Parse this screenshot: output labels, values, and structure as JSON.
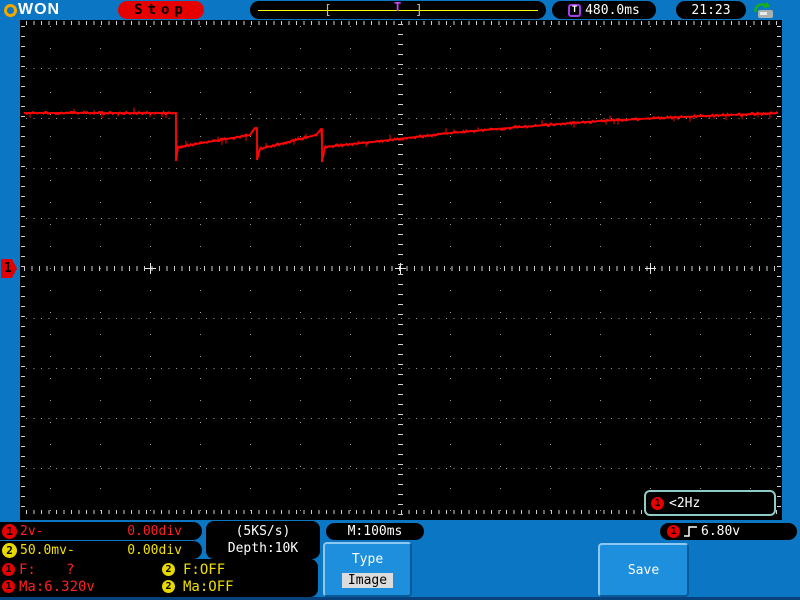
{
  "header": {
    "brand_suffix": "WON",
    "run_status": "Stop",
    "memory_bar": {
      "left_bracket": "[",
      "right_bracket": "]",
      "trigger_marker": "T"
    },
    "trigger_icon_letter": "T",
    "trigger_time": "480.0ms",
    "clock": "21:23",
    "usb_icon": "usb-save-icon"
  },
  "scope": {
    "channel_marker": "1",
    "freq_counter": {
      "channel_badge": "1",
      "value": "<2Hz"
    }
  },
  "footer": {
    "ch1": {
      "badge": "1",
      "scale": "2v-",
      "position": "0.00div"
    },
    "ch2": {
      "badge": "2",
      "scale": "50.0mv-",
      "position": "0.00div"
    },
    "sample_rate": "(5KS/s)",
    "depth": "Depth:10K",
    "timebase": "M:100ms",
    "trigger": {
      "badge": "1",
      "level": "6.80v"
    },
    "measurements": {
      "ch1_badge": "1",
      "ch2_badge": "2",
      "ch1_freq_label": "F:",
      "ch1_freq_value": "?",
      "ch1_max": "Ma:6.320v",
      "ch2_freq": "F:OFF",
      "ch2_max": "Ma:OFF"
    },
    "type_button": {
      "label": "Type",
      "value": "Image"
    },
    "save_button_label": "Save"
  },
  "colors": {
    "bezel_blue": "#0b76c4",
    "trace_red": "#ff0505",
    "ch1_red": "#ff2020",
    "ch2_yellow": "#f0e000",
    "status_red": "#e60000",
    "accent_purple": "#a43cf0",
    "mem_line_yellow": "#ffff00",
    "freq_border_teal": "#8fccc8",
    "grid_gray": "#9c9c9c"
  },
  "waveform": {
    "note": "CH1 trace, page pixel coords",
    "points": [
      [
        24,
        113
      ],
      [
        175,
        113
      ],
      [
        176,
        113
      ],
      [
        176,
        161
      ],
      [
        178,
        147
      ],
      [
        250,
        135
      ],
      [
        255,
        128
      ],
      [
        257,
        128
      ],
      [
        257,
        160
      ],
      [
        260,
        149
      ],
      [
        316,
        135
      ],
      [
        321,
        129
      ],
      [
        322,
        129
      ],
      [
        322,
        162
      ],
      [
        325,
        147
      ],
      [
        380,
        141
      ],
      [
        450,
        133
      ],
      [
        520,
        127
      ],
      [
        600,
        121
      ],
      [
        680,
        117
      ],
      [
        778,
        113
      ]
    ]
  }
}
